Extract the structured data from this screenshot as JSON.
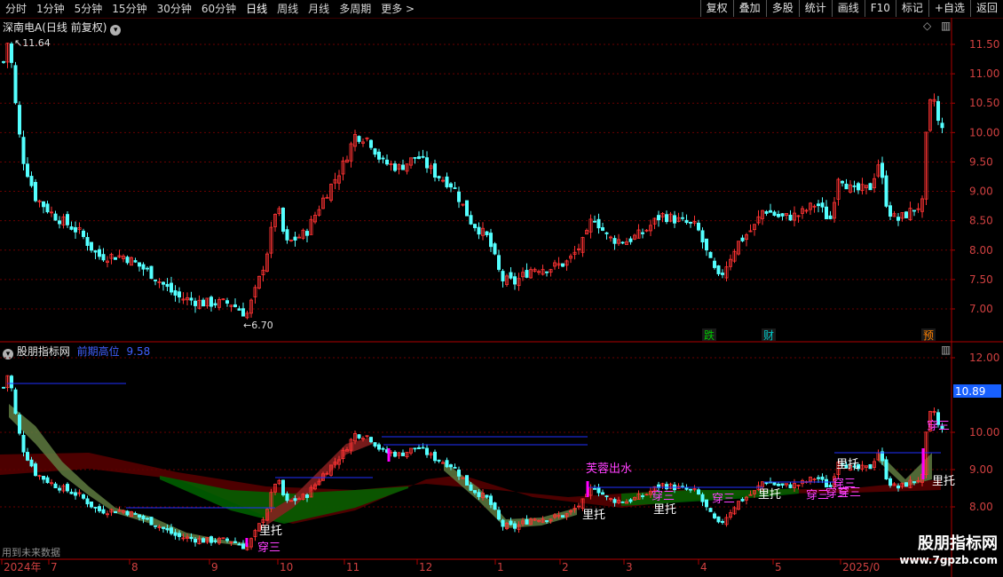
{
  "toolbar": {
    "periods": [
      "分时",
      "1分钟",
      "5分钟",
      "15分钟",
      "30分钟",
      "60分钟",
      "日线",
      "周线",
      "月线",
      "多周期",
      "更多 >"
    ],
    "active_period": "日线",
    "buttons": [
      "复权",
      "叠加",
      "多股",
      "统计",
      "画线",
      "F10",
      "标记",
      "+自选",
      "返回"
    ]
  },
  "main_panel": {
    "title": "深南电A(日线 前复权)",
    "high_label": "11.64",
    "low_label": "6.70",
    "price_ticks": [
      "11.50",
      "11.00",
      "10.50",
      "10.00",
      "9.50",
      "9.00",
      "8.50",
      "8.00",
      "7.50",
      "7.00"
    ],
    "event_labels": [
      {
        "text": "跌",
        "color": "#00c800"
      },
      {
        "text": "财",
        "color": "#00c8c8"
      },
      {
        "text": "预",
        "color": "#ff8000"
      }
    ]
  },
  "indicator_panel": {
    "title": "股朋指标网",
    "subtitle_label": "前期高位",
    "subtitle_value": "9.58",
    "price_ticks": [
      "12.00",
      "10.00",
      "9.00",
      "8.00"
    ],
    "current_price": "10.89",
    "footer_text": "用到未来数据",
    "signals": [
      {
        "text": "里托",
        "color": "#ffffff"
      },
      {
        "text": "穿三",
        "color": "#ff40ff"
      },
      {
        "text": "芙蓉出水",
        "color": "#ff40ff"
      },
      {
        "text": "里托",
        "color": "#ffffff"
      },
      {
        "text": "穿三",
        "color": "#ff40ff"
      },
      {
        "text": "里托",
        "color": "#ffffff"
      },
      {
        "text": "穿三",
        "color": "#ff40ff"
      },
      {
        "text": "里托",
        "color": "#ffffff"
      },
      {
        "text": "穿三",
        "color": "#ff40ff"
      },
      {
        "text": "穿三",
        "color": "#ff40ff"
      },
      {
        "text": "里托",
        "color": "#ffffff"
      },
      {
        "text": "穿三",
        "color": "#ff40ff"
      },
      {
        "text": "穿三",
        "color": "#ff40ff"
      },
      {
        "text": "里托",
        "color": "#ffffff"
      },
      {
        "text": "穿三",
        "color": "#ff40ff"
      }
    ]
  },
  "time_axis": {
    "labels": [
      "2024年",
      "7",
      "8",
      "9",
      "10",
      "11",
      "12",
      "1",
      "2",
      "3",
      "4",
      "5",
      "2025/0"
    ]
  },
  "colors": {
    "up": "#ff3333",
    "down": "#54ffff",
    "axis_red": "#b00000",
    "ma_cyan": "#00e5e5"
  },
  "watermark": {
    "title": "股朋指标网",
    "url": "www.7gpzb.com"
  }
}
